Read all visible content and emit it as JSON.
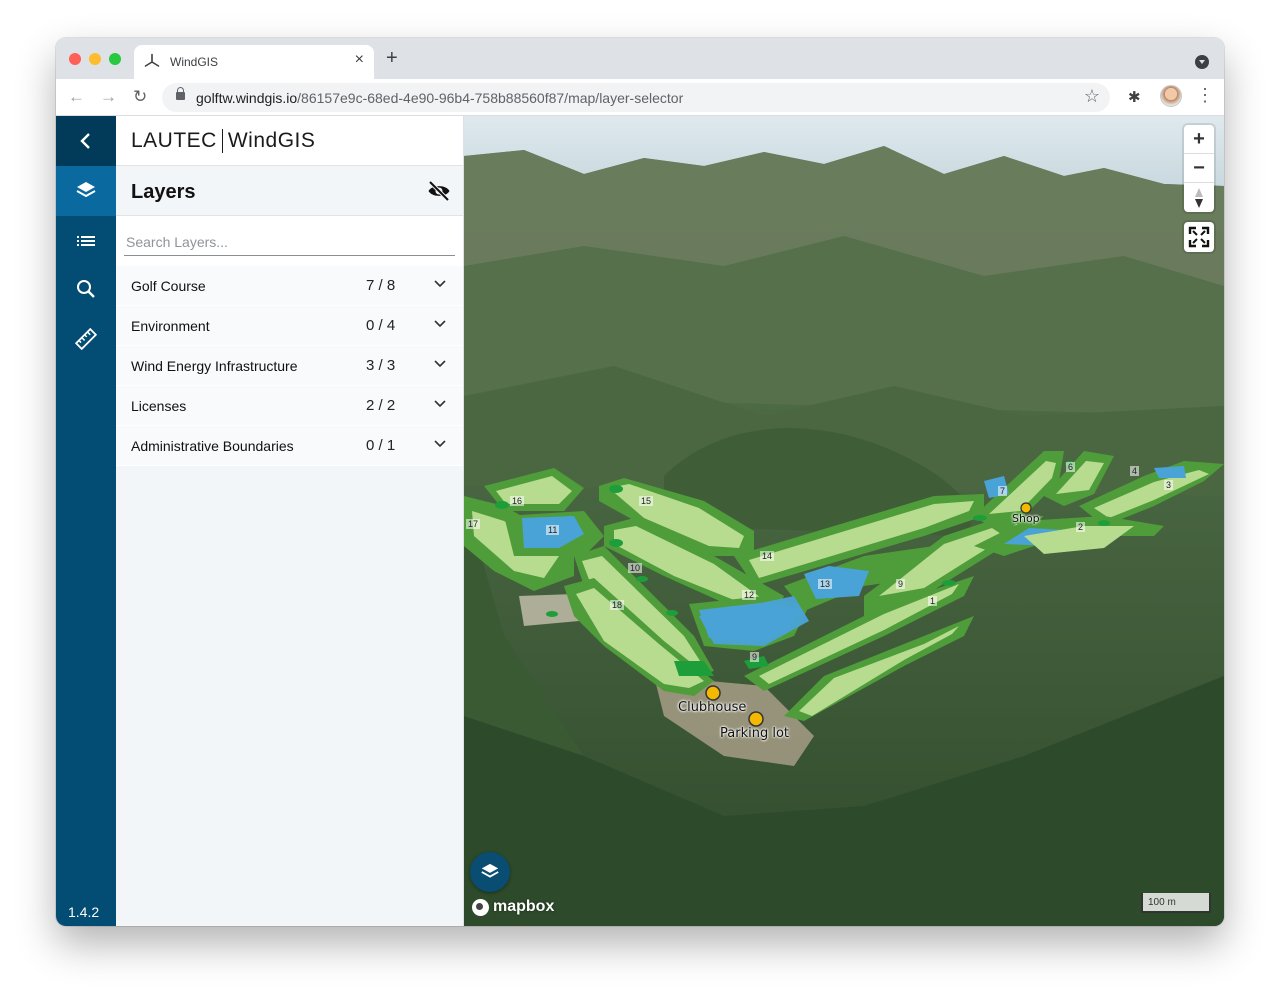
{
  "browser": {
    "tab_title": "WindGIS",
    "new_tab": "+",
    "url_host": "golftw.windgis.io",
    "url_path": "/86157e9c-68ed-4e90-96b4-758b88560f87/map/layer-selector"
  },
  "app": {
    "brand_left": "LAUTEC",
    "brand_right": "WindGIS",
    "version": "1.4.2"
  },
  "layers_panel": {
    "title": "Layers",
    "search_placeholder": "Search Layers...",
    "groups": [
      {
        "name": "Golf Course",
        "count": "7 / 8"
      },
      {
        "name": "Environment",
        "count": "0 / 4"
      },
      {
        "name": "Wind Energy Infrastructure",
        "count": "3 / 3"
      },
      {
        "name": "Licenses",
        "count": "2 / 2"
      },
      {
        "name": "Administrative Boundaries",
        "count": "0 / 1"
      }
    ]
  },
  "map": {
    "zoom_in": "+",
    "zoom_out": "−",
    "attribution": "mapbox",
    "scale_label": "100 m",
    "pois": [
      "Clubhouse",
      "Parking lot",
      "Shop"
    ],
    "holes": [
      "16",
      "15",
      "17",
      "11",
      "14",
      "10",
      "13",
      "12",
      "18",
      "9",
      "9",
      "1",
      "7",
      "6",
      "4",
      "3",
      "2"
    ]
  },
  "colors": {
    "rail": "#034c73",
    "rail_active": "#0a6aa0",
    "fairway": "#b7dc8f",
    "rough": "#4f9d3a",
    "green": "#1e9e3a",
    "water": "#4aa3d6",
    "poi": "#f5b800"
  }
}
